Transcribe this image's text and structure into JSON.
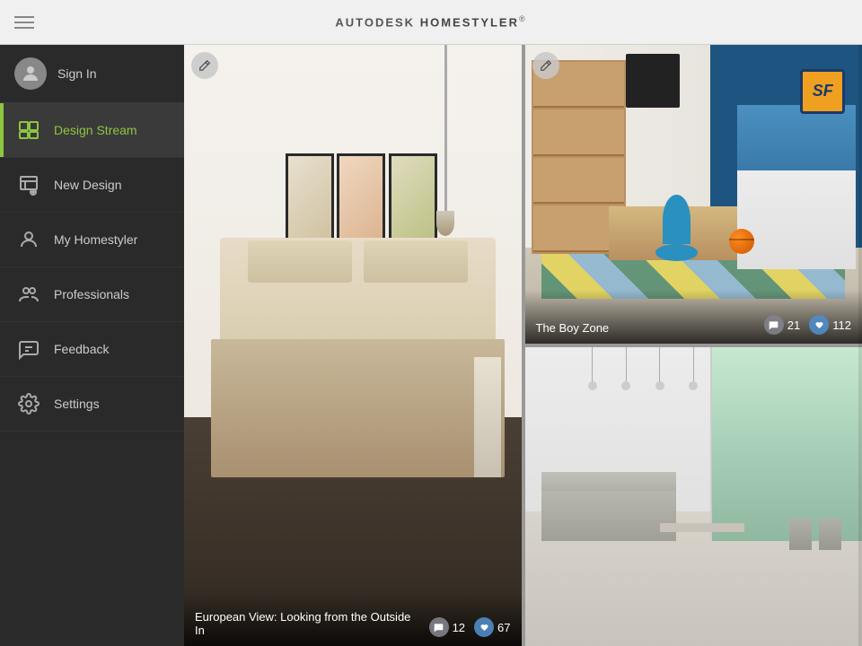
{
  "header": {
    "title_prefix": "AUTODESK",
    "title_main": "HOMESTYLER",
    "title_sup": "®",
    "menu_aria": "Open menu"
  },
  "sidebar": {
    "user": {
      "sign_in_label": "Sign In"
    },
    "nav_items": [
      {
        "id": "design-stream",
        "label": "Design Stream",
        "active": true
      },
      {
        "id": "new-design",
        "label": "New Design",
        "active": false
      },
      {
        "id": "my-homestyler",
        "label": "My Homestyler",
        "active": false
      },
      {
        "id": "professionals",
        "label": "Professionals",
        "active": false
      },
      {
        "id": "feedback",
        "label": "Feedback",
        "active": false
      },
      {
        "id": "settings",
        "label": "Settings",
        "active": false
      }
    ]
  },
  "cards": [
    {
      "id": "european-view",
      "title": "European View: Looking from the Outside In",
      "comments": "12",
      "likes": "67"
    },
    {
      "id": "boy-zone",
      "title": "The Boy Zone",
      "comments": "21",
      "likes": "112"
    },
    {
      "id": "modern-living",
      "title": "",
      "comments": "",
      "likes": ""
    }
  ]
}
